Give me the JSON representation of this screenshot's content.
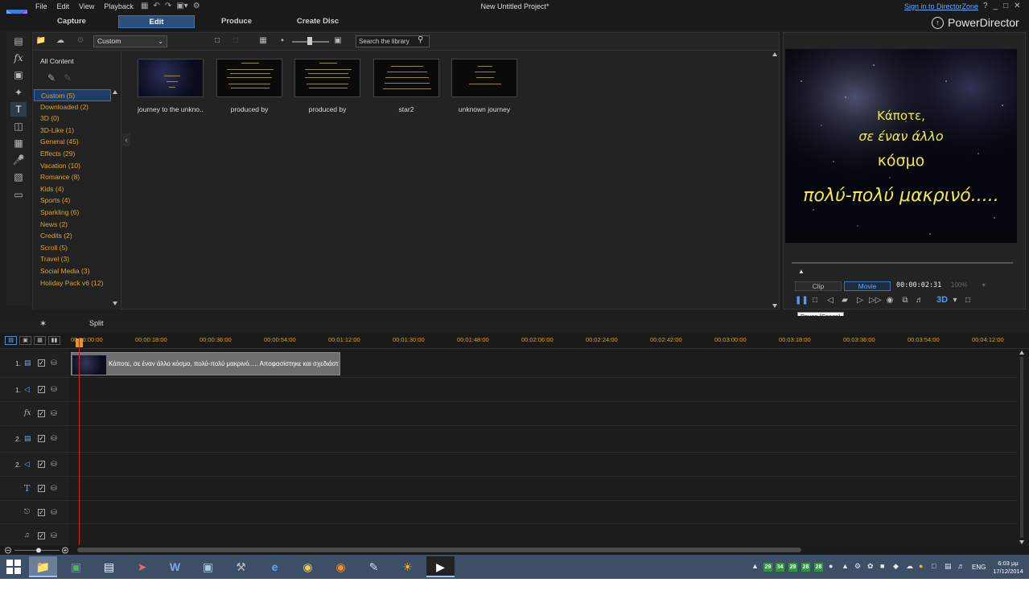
{
  "app": {
    "menu": [
      "File",
      "Edit",
      "View",
      "Playback"
    ],
    "project_title": "New Untitled Project*",
    "signin_link": "Sign in to DirectorZone",
    "window_buttons": [
      "?",
      "_",
      "□",
      "✕"
    ],
    "brand": "PowerDirector"
  },
  "modes": [
    {
      "label": "Capture",
      "active": false
    },
    {
      "label": "Edit",
      "active": true
    },
    {
      "label": "Produce",
      "active": false
    },
    {
      "label": "Create Disc",
      "active": false
    }
  ],
  "library": {
    "dropdown_value": "Custom",
    "search_placeholder": "Search the library",
    "all_content_label": "All Content",
    "categories": [
      "Custom  (5)",
      "Downloaded  (2)",
      "3D  (0)",
      "3D-Like  (1)",
      "General  (45)",
      "Effects  (29)",
      "Vacation  (10)",
      "Romance  (8)",
      "Kids  (4)",
      "Sports  (4)",
      "Sparkling  (6)",
      "News  (2)",
      "Credits  (2)",
      "Scroll  (5)",
      "Travel  (3)",
      "Social Media  (3)",
      "Holiday Pack v6  (12)"
    ],
    "selected_category": 0,
    "items": [
      {
        "label": "journey to the unkno..."
      },
      {
        "label": "produced by"
      },
      {
        "label": "produced by"
      },
      {
        "label": "star2"
      },
      {
        "label": "unknown journey"
      }
    ]
  },
  "preview": {
    "title_lines": [
      "Κάποτε,",
      "σε έναν άλλο",
      "κόσμο",
      "πολύ-πολύ μακρινό....."
    ],
    "title_color": "#f0ea45",
    "clip_label": "Clip",
    "movie_label": "Movie",
    "timecode": "00:00:02:31",
    "zoom": "100%",
    "badge_3d": "3D",
    "tooltip": "Pause (Space)"
  },
  "timeline": {
    "split_label": "Split",
    "ticks": [
      "00:00:00:00",
      "00:00:18:00",
      "00:00:36:00",
      "00:00:54:00",
      "00:01:12:00",
      "00:01:30:00",
      "00:01:48:00",
      "00:02:06:00",
      "00:02:24:00",
      "00:02:42:00",
      "00:03:00:00",
      "00:03:18:00",
      "00:03:36:00",
      "00:03:54:00",
      "00:04:12:00"
    ],
    "tracks": [
      {
        "num": "1.",
        "icon": "video-track-icon"
      },
      {
        "num": "1.",
        "icon": "audio-track-icon"
      },
      {
        "num": "",
        "icon": "fx-track-icon"
      },
      {
        "num": "2.",
        "icon": "video-track-icon"
      },
      {
        "num": "2.",
        "icon": "audio-track-icon"
      },
      {
        "num": "",
        "icon": "title-track-icon"
      },
      {
        "num": "",
        "icon": "voice-track-icon"
      },
      {
        "num": "",
        "icon": "music-track-icon"
      }
    ],
    "clip_label": "Κάποτε, σε έναν άλλο κόσμο, πολύ-πολύ μακρινό..... Αποφασίστηκε και σχεδιάστ"
  },
  "taskbar": {
    "tray_numbers": [
      "29",
      "34",
      "29",
      "28",
      "28"
    ],
    "language": "ENG",
    "time": "6:03 μμ",
    "date": "17/12/2014"
  }
}
